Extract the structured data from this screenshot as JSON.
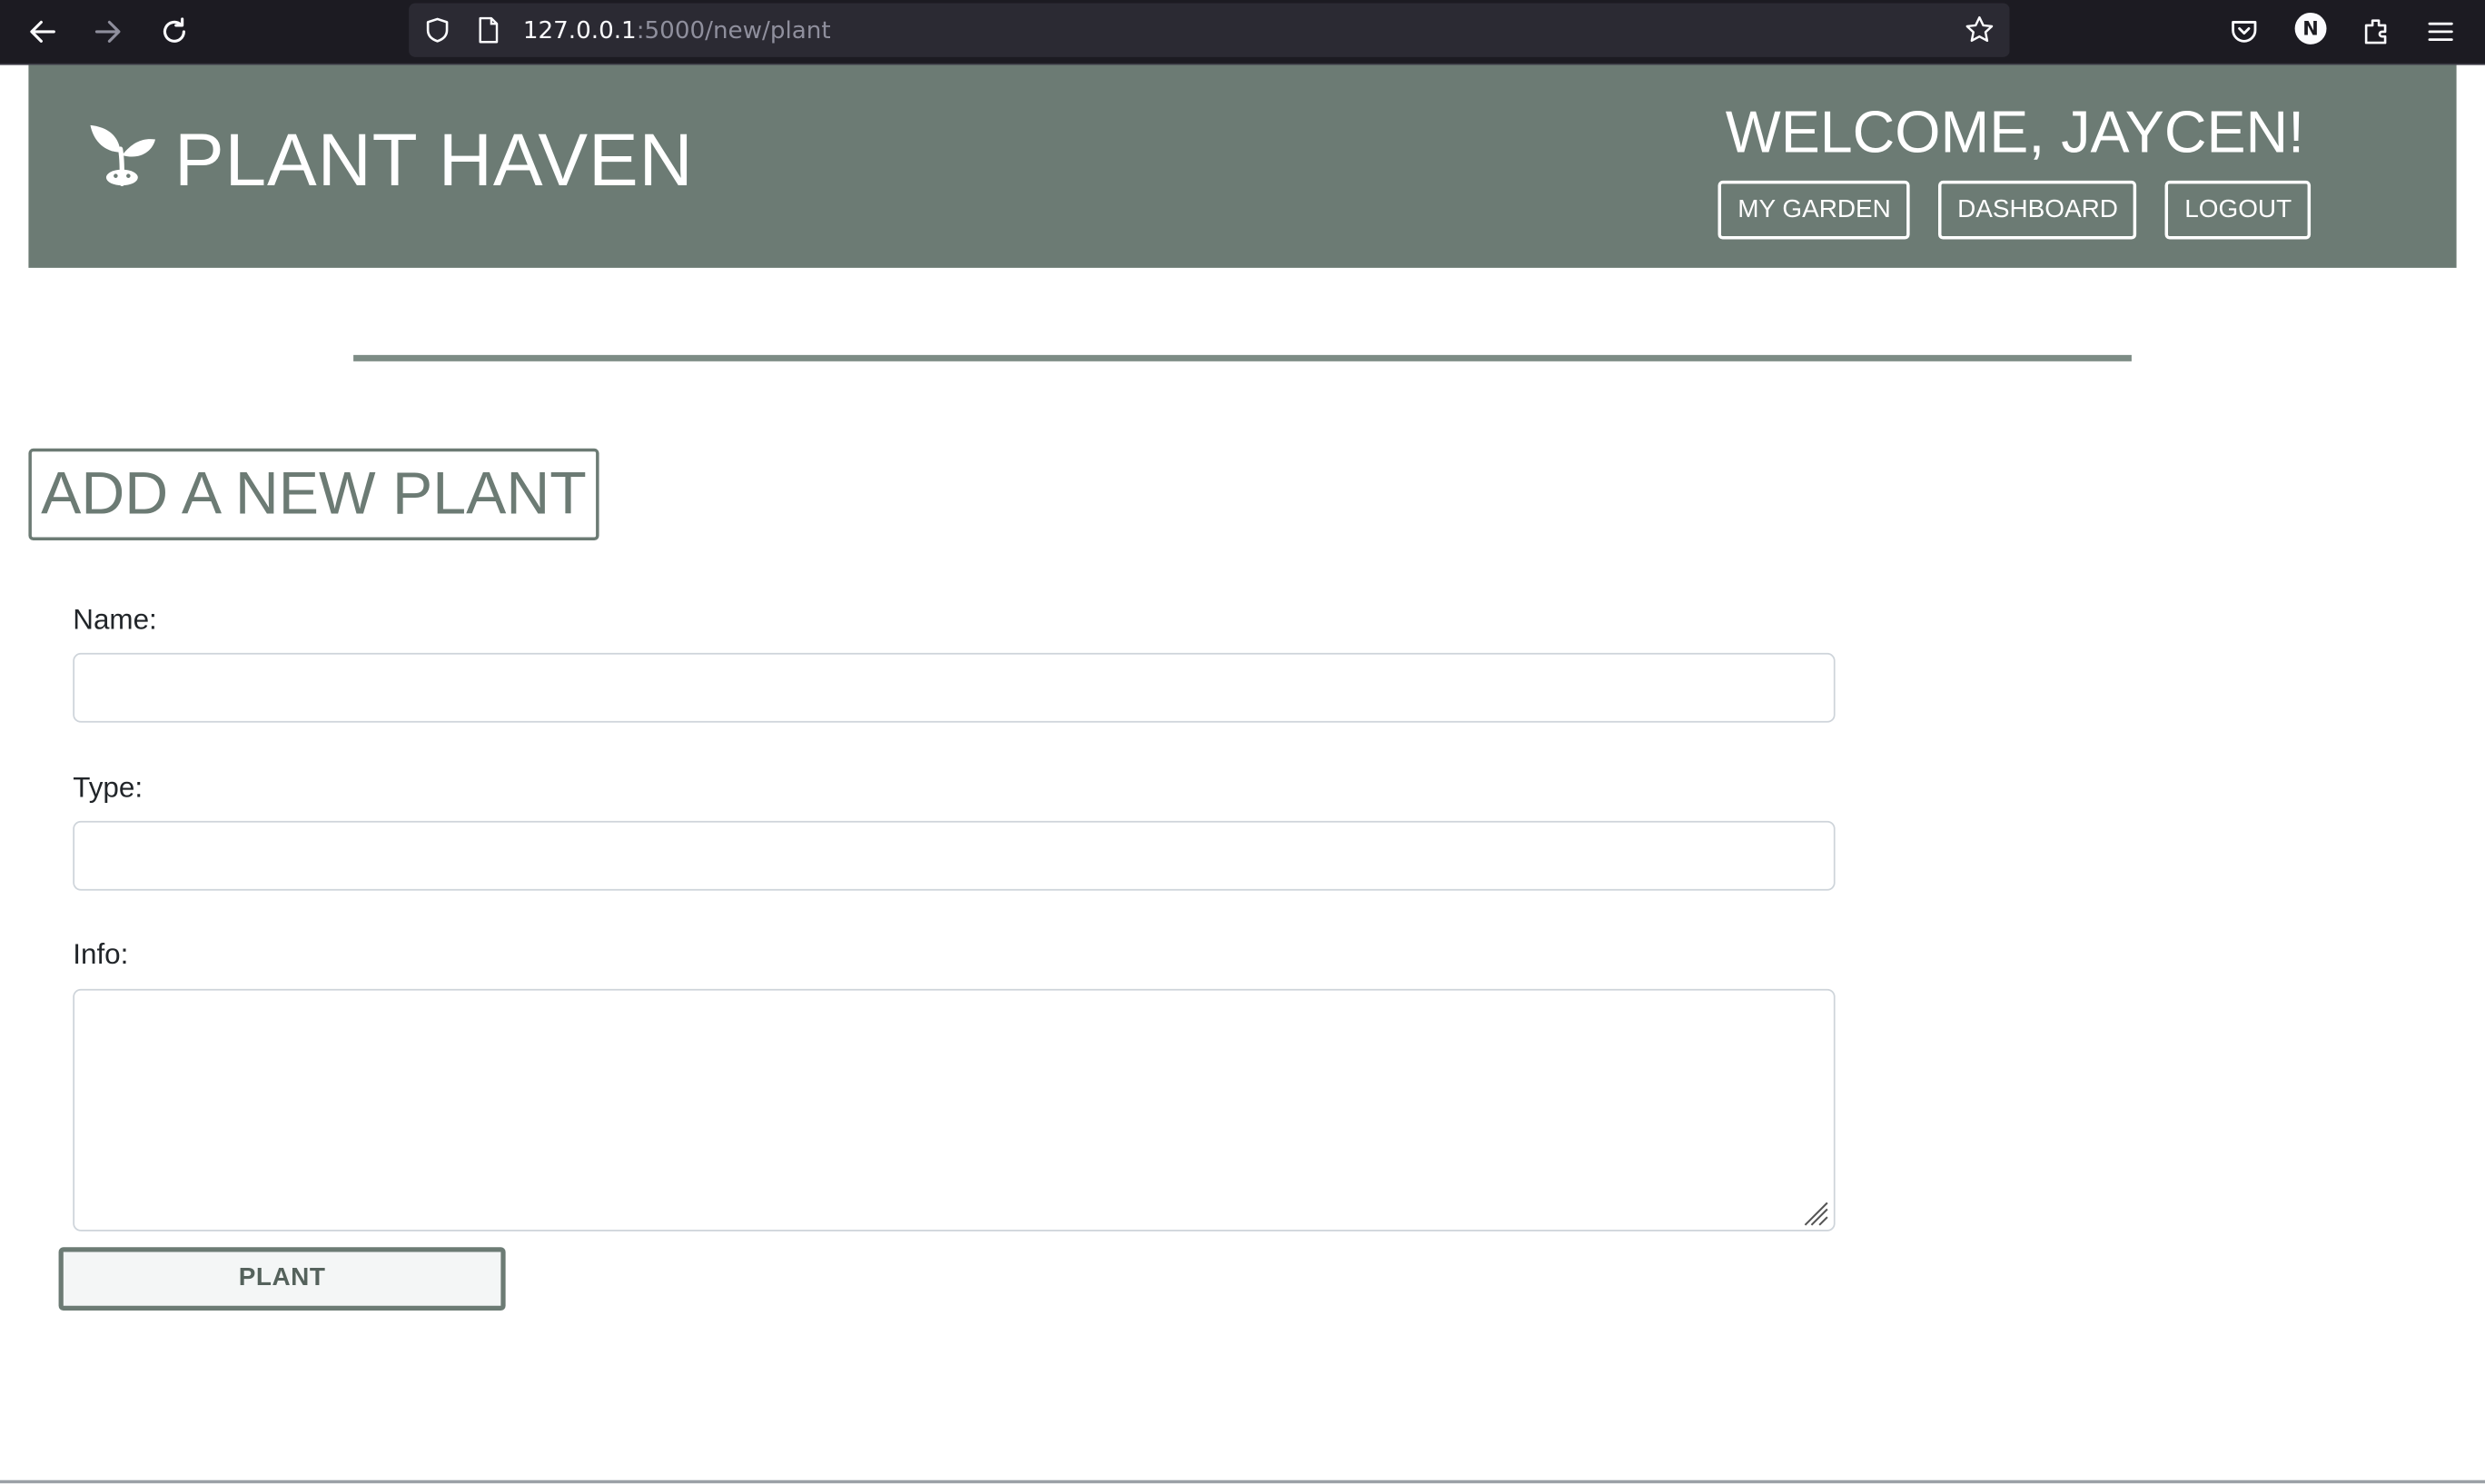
{
  "browser": {
    "url_host": "127.0.0.1",
    "url_rest": ":5000/new/plant",
    "profile_initial": "N",
    "icons": [
      "back-icon",
      "forward-icon",
      "reload-icon",
      "shield-icon",
      "page-icon",
      "star-icon",
      "pocket-icon",
      "extensions-icon",
      "menu-icon"
    ]
  },
  "header": {
    "brand": "PLANT HAVEN",
    "logo_icon": "plant-sprout-icon",
    "welcome": "WELCOME, JAYCEN!",
    "nav": [
      "MY GARDEN",
      "DASHBOARD",
      "LOGOUT"
    ]
  },
  "form": {
    "title": "ADD A NEW PLANT",
    "name_label": "Name:",
    "name_value": "",
    "type_label": "Type:",
    "type_value": "",
    "info_label": "Info:",
    "info_value": "",
    "submit_label": "PLANT"
  },
  "colors": {
    "header_bg": "#6c7b74",
    "accent": "#6c7b74",
    "browser_bg": "#1c1b22"
  }
}
